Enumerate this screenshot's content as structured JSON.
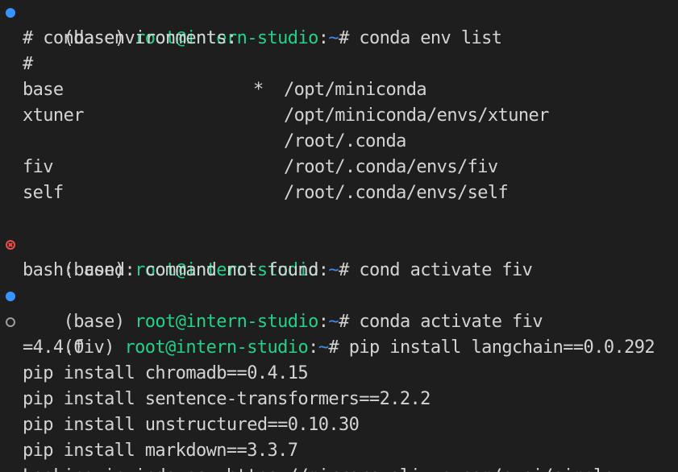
{
  "terminal": {
    "prompt_env": "(base)",
    "prompt_env_fiv": "(fiv)",
    "user_host": "root@intern-studio",
    "sep": ":",
    "cwd": "~",
    "hash": "#",
    "status_colors": {
      "ok": "#3794ff",
      "error": "#f14c4c",
      "pending": "#9d9d9d"
    },
    "status_icons": {
      "ok": "dot-success-icon",
      "error": "circle-x-error-icon",
      "pending": "circle-pending-icon"
    },
    "lines": {
      "cmd1": " conda env list",
      "out1": "# conda environments:",
      "out2": "#",
      "env_rows": [
        {
          "name": "base",
          "mark": "*",
          "path": "/opt/miniconda"
        },
        {
          "name": "xtuner",
          "mark": "",
          "path": "/opt/miniconda/envs/xtuner"
        },
        {
          "name": "",
          "mark": "",
          "path": "/root/.conda"
        },
        {
          "name": "fiv",
          "mark": "",
          "path": "/root/.conda/envs/fiv"
        },
        {
          "name": "self",
          "mark": "",
          "path": "/root/.conda/envs/self"
        }
      ],
      "cmd2": " cond activate fiv",
      "out3": "bash: cond: command not found",
      "cmd3": " conda activate fiv",
      "cmd4": " pip install langchain==0.0.292",
      "wrap1": "=4.4.0",
      "pip1": "pip install chromadb==0.4.15",
      "pip2": "pip install sentence-transformers==2.2.2",
      "pip3": "pip install unstructured==0.10.30",
      "pip4": "pip install markdown==3.3.7",
      "partial": "Looking in indexes: https://mirrors.aliyun.com/pypi/simple"
    }
  }
}
